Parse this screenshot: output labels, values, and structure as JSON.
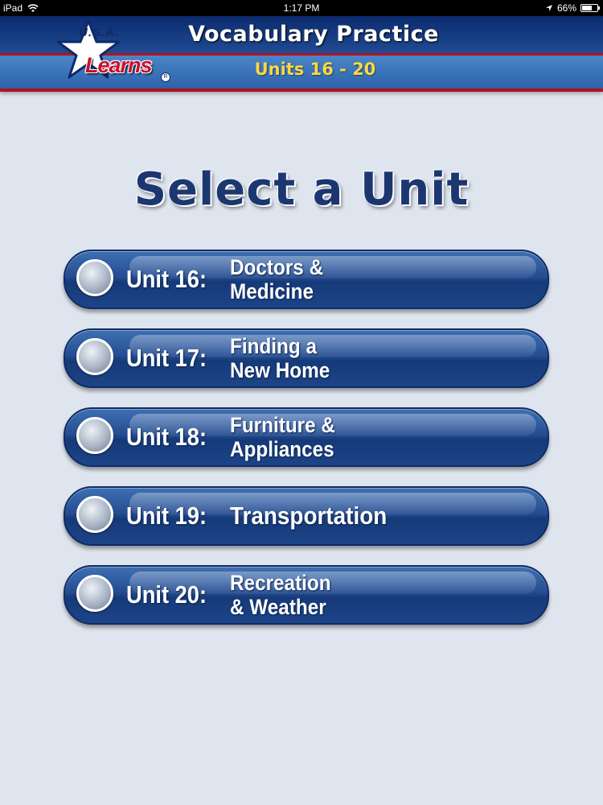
{
  "status_bar": {
    "device": "iPad",
    "time": "1:17 PM",
    "battery": "66%",
    "battery_level": 0.66
  },
  "header": {
    "title": "Vocabulary Practice",
    "subtitle": "Units 16 - 20",
    "logo_top": "U.S.A.",
    "logo_bottom": "Learns",
    "logo_reg": "R"
  },
  "page_title": "Select a Unit",
  "units": [
    {
      "label": "Unit 16:",
      "topic": [
        "Doctors &",
        "Medicine"
      ]
    },
    {
      "label": "Unit 17:",
      "topic": [
        "Finding a",
        "New Home"
      ]
    },
    {
      "label": "Unit 18:",
      "topic": [
        "Furniture &",
        "Appliances"
      ]
    },
    {
      "label": "Unit 19:",
      "topic": [
        "Transportation"
      ]
    },
    {
      "label": "Unit 20:",
      "topic": [
        "Recreation",
        "& Weather"
      ]
    }
  ],
  "colors": {
    "header_dark": "#0c2b6e",
    "accent_red": "#b3121e",
    "subtitle_yellow": "#ffd83d",
    "button_blue": "#254d91",
    "background": "#dfe5ee"
  }
}
